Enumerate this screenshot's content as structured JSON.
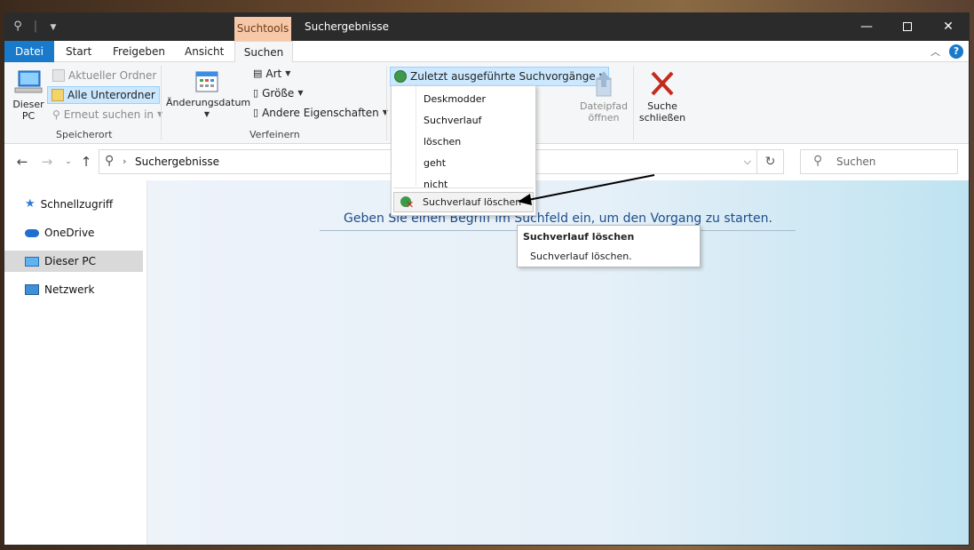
{
  "window": {
    "title": "Suchergebnisse",
    "context_tab": "Suchtools"
  },
  "ribbon_tabs": {
    "file": "Datei",
    "start": "Start",
    "share": "Freigeben",
    "view": "Ansicht",
    "search": "Suchen"
  },
  "ribbon": {
    "location": {
      "this_pc_line1": "Dieser",
      "this_pc_line2": "PC",
      "current_folder": "Aktueller Ordner",
      "all_subfolders": "Alle Unterordner",
      "search_again": "Erneut suchen in",
      "group_label": "Speicherort"
    },
    "refine": {
      "date_modified": "Änderungsdatum",
      "type": "Art",
      "size": "Größe",
      "other_props": "Andere Eigenschaften",
      "group_label": "Verfeinern"
    },
    "options": {
      "recent_searches": "Zuletzt ausgeführte Suchvorgänge",
      "open_path_line1": "Dateipfad",
      "open_path_line2": "öffnen",
      "close_search_line1": "Suche",
      "close_search_line2": "schließen"
    }
  },
  "address_bar": {
    "path": "Suchergebnisse",
    "search_placeholder": "Suchen"
  },
  "nav": {
    "items": [
      {
        "label": "Schnellzugriff"
      },
      {
        "label": "OneDrive"
      },
      {
        "label": "Dieser PC"
      },
      {
        "label": "Netzwerk"
      }
    ]
  },
  "content": {
    "hint": "Geben Sie einen Begriff im Suchfeld ein, um den Vorgang zu starten."
  },
  "recent_menu": {
    "items": [
      "Deskmodder",
      "Suchverlauf",
      "löschen",
      "geht",
      "nicht"
    ],
    "clear_label": "Suchverlauf löschen"
  },
  "tooltip": {
    "title": "Suchverlauf löschen",
    "description": "Suchverlauf löschen."
  },
  "colors": {
    "accent": "#1979ca",
    "context_tab": "#f6c8a8",
    "close_red": "#c42b1c"
  }
}
